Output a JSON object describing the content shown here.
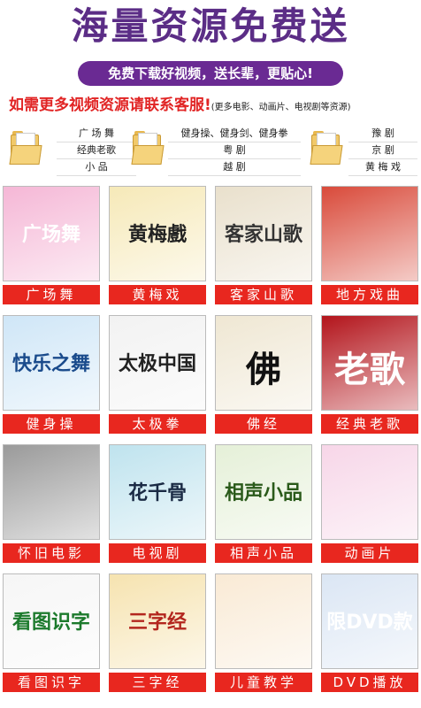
{
  "header": {
    "title": "海量资源免费送",
    "slogan": "免费下载好视频，送长辈，更贴心!",
    "contact_main": "如需更多视频资源请联系客服!",
    "contact_sub": "(更多电影、动画片、电视剧等资源)"
  },
  "categories": [
    {
      "rows": [
        "广 场 舞",
        "经典老歌",
        "小    品"
      ]
    },
    {
      "rows": [
        "健身操、健身剑、健身拳",
        "粤    剧",
        "越    剧"
      ]
    },
    {
      "rows": [
        "豫    剧",
        "京    剧",
        "黄 梅 戏"
      ]
    }
  ],
  "tiles": [
    {
      "caption": "广场舞",
      "art": "广场舞",
      "bg": "#f5b7d6",
      "fg": "#ffffff"
    },
    {
      "caption": "黄梅戏",
      "art": "黄梅戲",
      "bg": "#f6e9b8",
      "fg": "#222222"
    },
    {
      "caption": "客家山歌",
      "art": "客家山歌",
      "bg": "#e9e0cc",
      "fg": "#333333"
    },
    {
      "caption": "地方戏曲",
      "art": "",
      "bg": "#d94a3a",
      "fg": "#ffffff"
    },
    {
      "caption": "健身操",
      "art": "快乐之舞",
      "bg": "#cfe6f7",
      "fg": "#1a4b8c"
    },
    {
      "caption": "太极拳",
      "art": "太极中国",
      "bg": "#f2f2f2",
      "fg": "#222222"
    },
    {
      "caption": "佛经",
      "art": "佛",
      "bg": "#efe7d3",
      "fg": "#111111"
    },
    {
      "caption": "经典老歌",
      "art": "老歌",
      "bg": "#b3141b",
      "fg": "#ffffff"
    },
    {
      "caption": "怀旧电影",
      "art": "",
      "bg": "#9a9a9a",
      "fg": "#ffffff"
    },
    {
      "caption": "电视剧",
      "art": "花千骨",
      "bg": "#bfe3ee",
      "fg": "#1a2a44"
    },
    {
      "caption": "相声小品",
      "art": "相声小品",
      "bg": "#e5f0d8",
      "fg": "#2a5a1a"
    },
    {
      "caption": "动画片",
      "art": "",
      "bg": "#f7d6e8",
      "fg": "#333333"
    },
    {
      "caption": "看图识字",
      "art": "看图识字",
      "bg": "#f6f6f6",
      "fg": "#1c7a2c"
    },
    {
      "caption": "三字经",
      "art": "三字经",
      "bg": "#f6e3b0",
      "fg": "#b3261e"
    },
    {
      "caption": "儿童教学",
      "art": "",
      "bg": "#f9ead5",
      "fg": "#333333"
    },
    {
      "caption": "DVD播放",
      "art": "限DVD款",
      "bg": "#dbe6f4",
      "fg": "#ffffff"
    }
  ]
}
